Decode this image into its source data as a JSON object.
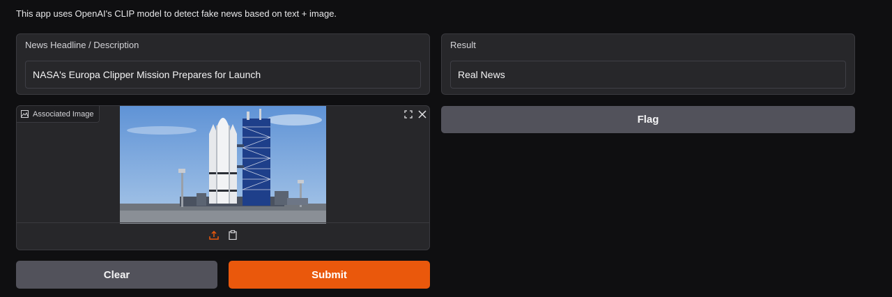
{
  "description": "This app uses OpenAI's CLIP model to detect fake news based on text + image.",
  "headline": {
    "label": "News Headline / Description",
    "value": "NASA's Europa Clipper Mission Prepares for Launch"
  },
  "result": {
    "label": "Result",
    "value": "Real News"
  },
  "image": {
    "label": "Associated Image"
  },
  "buttons": {
    "flag": "Flag",
    "clear": "Clear",
    "submit": "Submit"
  },
  "colors": {
    "background": "#0f0f11",
    "panel": "#27272a",
    "primary": "#ea580c",
    "secondary": "#52525b"
  }
}
